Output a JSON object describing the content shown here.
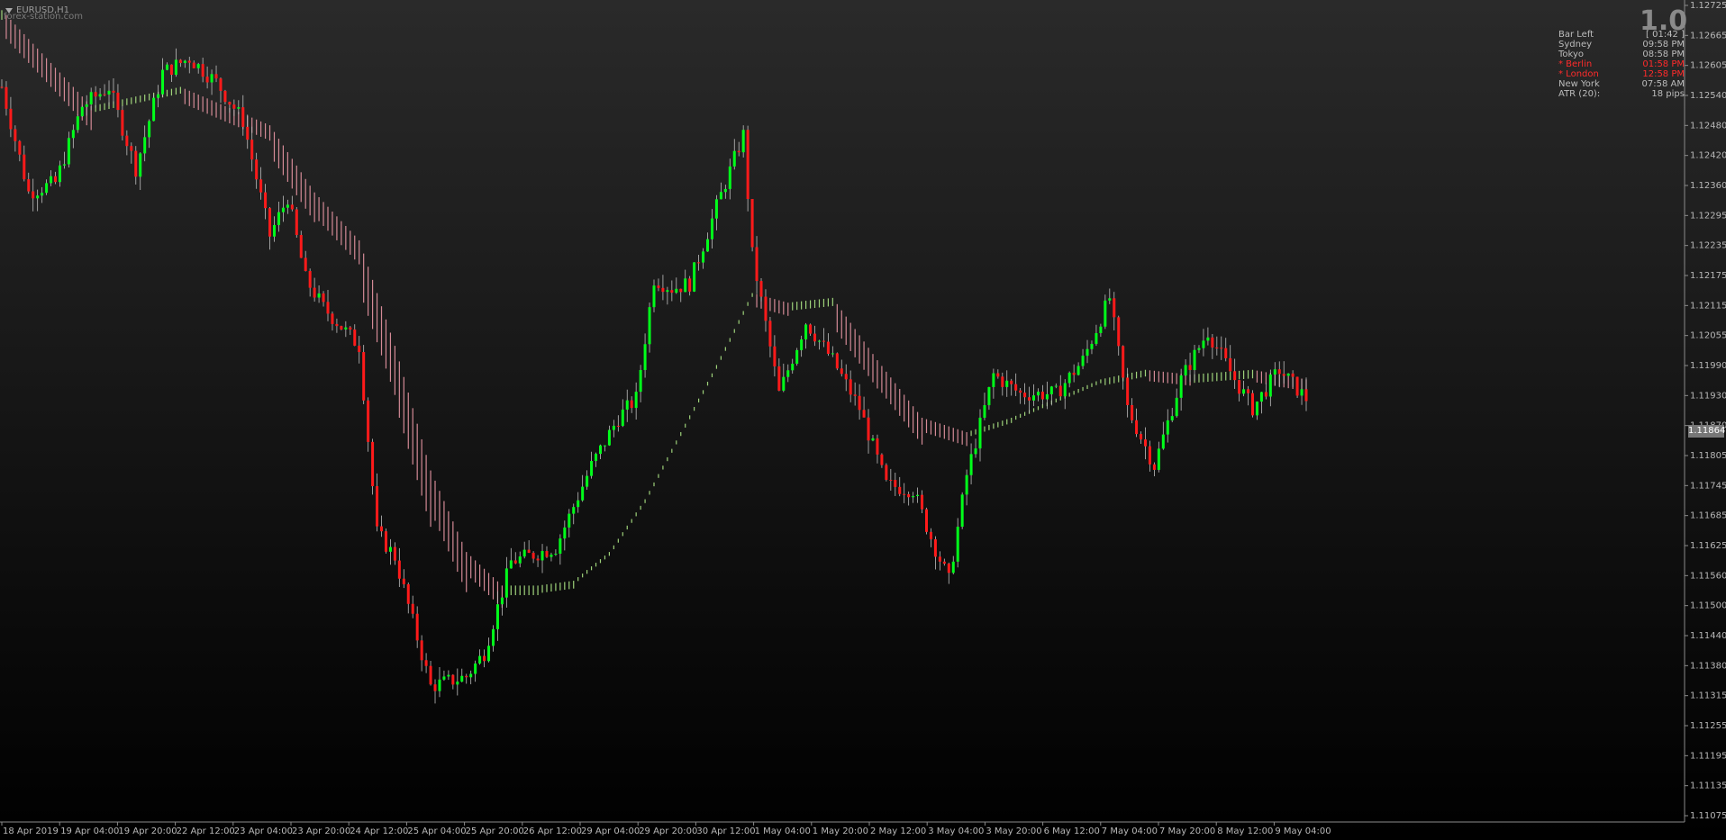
{
  "header": {
    "symbol": "EURUSD,H1",
    "watermark": "forex-station.com"
  },
  "panel": {
    "big_value": "1.0",
    "rows": [
      {
        "label": "Bar Left",
        "value": "[ 01:42 ]",
        "highlight": false
      },
      {
        "label": "Sydney",
        "value": "09:58 PM",
        "highlight": false
      },
      {
        "label": "Tokyo",
        "value": "08:58 PM",
        "highlight": false
      },
      {
        "label": "* Berlin",
        "value": "01:58 PM",
        "highlight": true
      },
      {
        "label": "* London",
        "value": "12:58 PM",
        "highlight": true
      },
      {
        "label": "New York",
        "value": "07:58 AM",
        "highlight": false
      },
      {
        "label": "ATR (20):",
        "value": "18 pips",
        "highlight": false
      }
    ]
  },
  "current_price": "1.11864",
  "colors": {
    "bull": "#00ff1a",
    "bear": "#ff1a1a",
    "ribbon_up": "#9ed27a",
    "ribbon_down": "#d48a96",
    "axis": "#b8b8b8"
  },
  "chart_data": {
    "type": "candlestick",
    "y_ticks": [
      "1.12725",
      "1.12665",
      "1.12605",
      "1.12540",
      "1.12480",
      "1.12420",
      "1.12360",
      "1.12295",
      "1.12235",
      "1.12175",
      "1.12115",
      "1.12055",
      "1.11990",
      "1.11930",
      "1.11870",
      "1.11805",
      "1.11745",
      "1.11685",
      "1.11625",
      "1.11560",
      "1.11500",
      "1.11440",
      "1.11380",
      "1.11315",
      "1.11255",
      "1.11195",
      "1.11135",
      "1.11075"
    ],
    "x_ticks": [
      "18 Apr 2019",
      "19 Apr 04:00",
      "19 Apr 20:00",
      "22 Apr 12:00",
      "23 Apr 04:00",
      "23 Apr 20:00",
      "24 Apr 12:00",
      "25 Apr 04:00",
      "25 Apr 20:00",
      "26 Apr 12:00",
      "29 Apr 04:00",
      "29 Apr 20:00",
      "30 Apr 12:00",
      "1 May 04:00",
      "1 May 20:00",
      "2 May 12:00",
      "3 May 04:00",
      "3 May 20:00",
      "6 May 12:00",
      "7 May 04:00",
      "7 May 20:00",
      "8 May 12:00",
      "9 May 04:00"
    ],
    "ylim": [
      1.1105,
      1.1274
    ],
    "anchors_close": [
      [
        0,
        1.1257
      ],
      [
        6,
        1.1235
      ],
      [
        12,
        1.1237
      ],
      [
        18,
        1.1253
      ],
      [
        24,
        1.1257
      ],
      [
        30,
        1.124
      ],
      [
        36,
        1.126
      ],
      [
        42,
        1.1263
      ],
      [
        48,
        1.1258
      ],
      [
        54,
        1.125
      ],
      [
        60,
        1.1226
      ],
      [
        64,
        1.1234
      ],
      [
        68,
        1.1217
      ],
      [
        72,
        1.1211
      ],
      [
        80,
        1.1203
      ],
      [
        84,
        1.1164
      ],
      [
        88,
        1.1159
      ],
      [
        96,
        1.1132
      ],
      [
        104,
        1.1134
      ],
      [
        108,
        1.1139
      ],
      [
        114,
        1.1158
      ],
      [
        124,
        1.1161
      ],
      [
        132,
        1.1178
      ],
      [
        138,
        1.1188
      ],
      [
        142,
        1.1192
      ],
      [
        146,
        1.1217
      ],
      [
        150,
        1.1215
      ],
      [
        154,
        1.1216
      ],
      [
        160,
        1.1232
      ],
      [
        166,
        1.1247
      ],
      [
        168,
        1.1222
      ],
      [
        174,
        1.1193
      ],
      [
        180,
        1.1208
      ],
      [
        186,
        1.12
      ],
      [
        192,
        1.119
      ],
      [
        198,
        1.1174
      ],
      [
        204,
        1.1173
      ],
      [
        208,
        1.1163
      ],
      [
        212,
        1.1154
      ],
      [
        216,
        1.1176
      ],
      [
        222,
        1.1197
      ],
      [
        228,
        1.1193
      ],
      [
        236,
        1.1193
      ],
      [
        242,
        1.12
      ],
      [
        248,
        1.1213
      ],
      [
        252,
        1.119
      ],
      [
        258,
        1.1178
      ],
      [
        264,
        1.1196
      ],
      [
        270,
        1.1206
      ],
      [
        276,
        1.1196
      ],
      [
        280,
        1.119
      ],
      [
        286,
        1.1198
      ],
      [
        292,
        1.1192
      ]
    ],
    "anchors_ma": [
      [
        0,
        1.1273
      ],
      [
        20,
        1.1253
      ],
      [
        40,
        1.1257
      ],
      [
        60,
        1.1249
      ],
      [
        70,
        1.1235
      ],
      [
        80,
        1.1225
      ],
      [
        88,
        1.1203
      ],
      [
        96,
        1.1177
      ],
      [
        104,
        1.116
      ],
      [
        112,
        1.1153
      ],
      [
        120,
        1.1153
      ],
      [
        128,
        1.1154
      ],
      [
        136,
        1.116
      ],
      [
        144,
        1.1171
      ],
      [
        152,
        1.1185
      ],
      [
        160,
        1.1199
      ],
      [
        168,
        1.1214
      ],
      [
        176,
        1.1212
      ],
      [
        186,
        1.1213
      ],
      [
        196,
        1.12
      ],
      [
        206,
        1.1188
      ],
      [
        216,
        1.1185
      ],
      [
        226,
        1.1188
      ],
      [
        236,
        1.1192
      ],
      [
        246,
        1.1196
      ],
      [
        256,
        1.1198
      ],
      [
        266,
        1.1197
      ],
      [
        280,
        1.1198
      ],
      [
        292,
        1.1196
      ]
    ]
  }
}
